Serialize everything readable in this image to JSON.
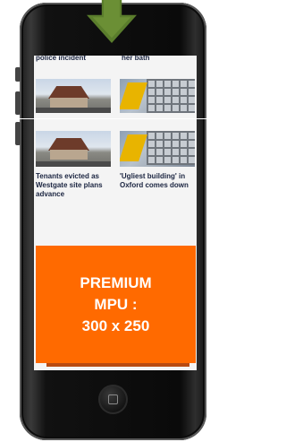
{
  "screen": {
    "top_headline_left": "police incident",
    "top_headline_right": "her bath",
    "stories": [
      {
        "headline": "Tenants evicted as Westgate site plans advance"
      },
      {
        "headline": "'Ugliest building' in Oxford comes down"
      }
    ]
  },
  "ad": {
    "line1": "PREMIUM",
    "line2": "MPU :",
    "line3": "300 x 250",
    "color": "#ff6a00"
  },
  "arrow": {
    "color": "#5a7d2c"
  }
}
